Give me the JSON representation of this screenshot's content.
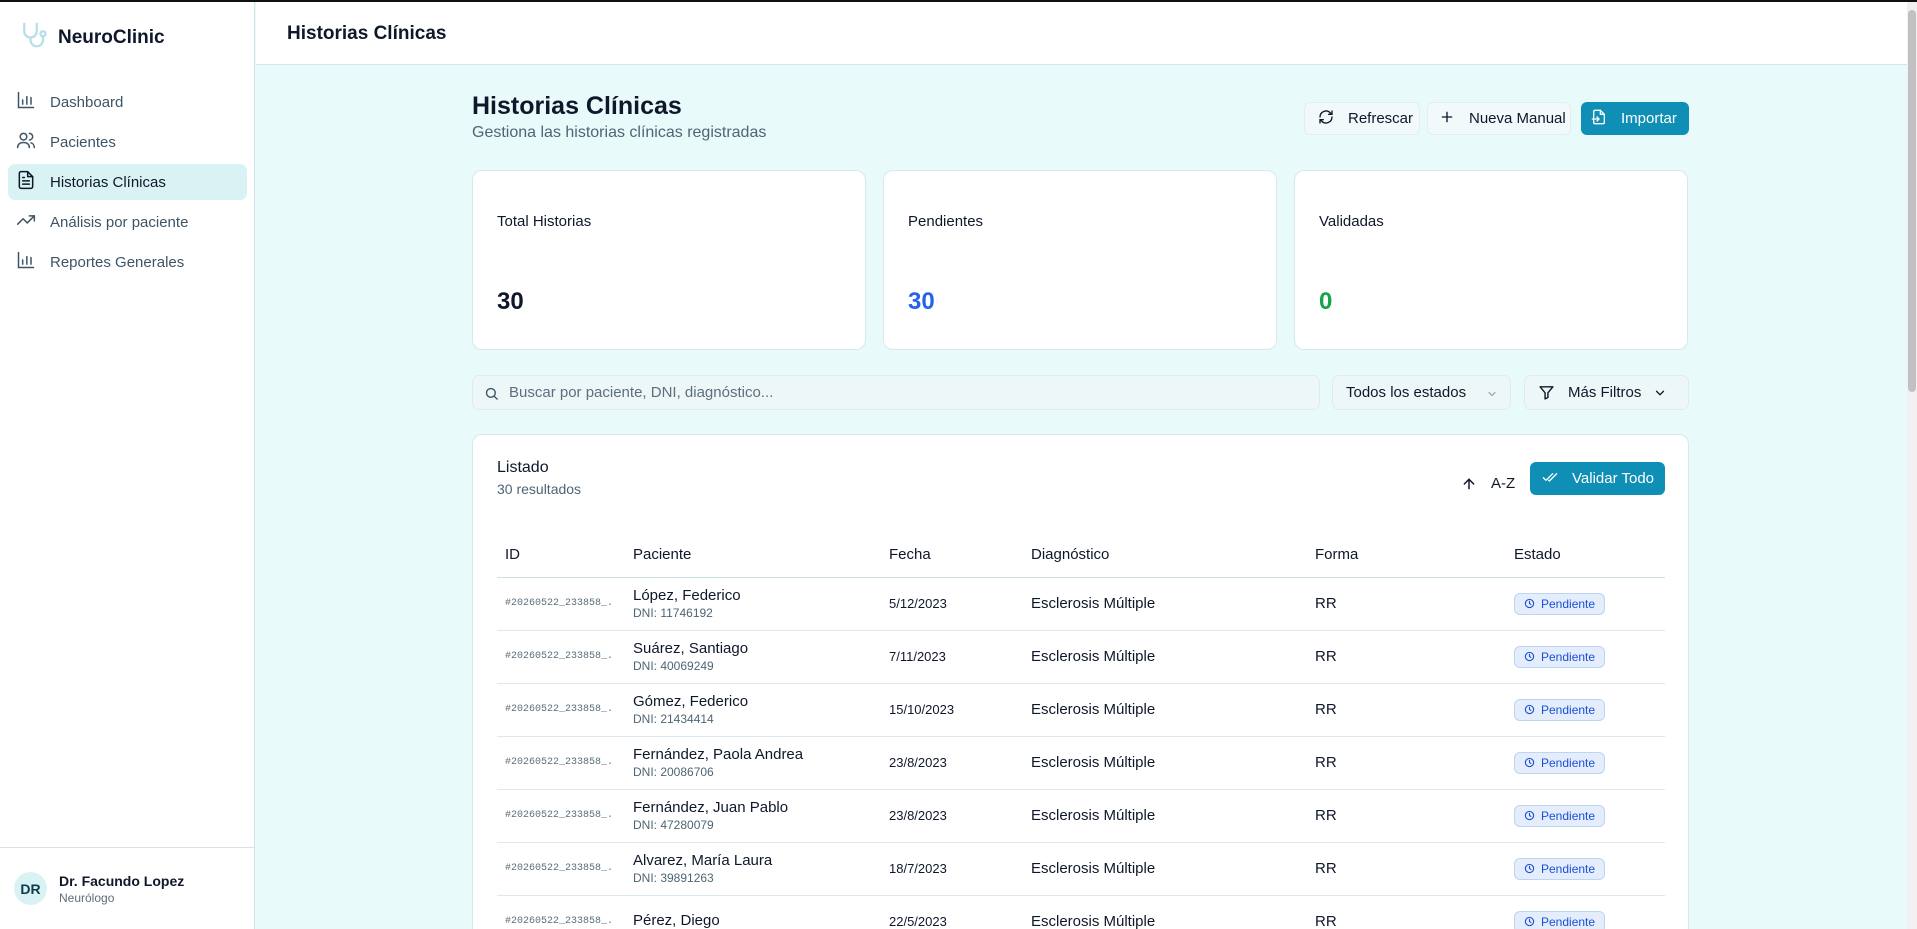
{
  "app": {
    "name": "NeuroClinic"
  },
  "sidebar": {
    "items": [
      {
        "label": "Dashboard",
        "icon": "bar-chart-icon",
        "active": false
      },
      {
        "label": "Pacientes",
        "icon": "users-icon",
        "active": false
      },
      {
        "label": "Historias Clínicas",
        "icon": "file-text-icon",
        "active": true
      },
      {
        "label": "Análisis por paciente",
        "icon": "trending-up-icon",
        "active": false
      },
      {
        "label": "Reportes Generales",
        "icon": "bar-chart-icon",
        "active": false
      }
    ],
    "user": {
      "initials": "DR",
      "name": "Dr. Facundo Lopez",
      "role": "Neurólogo"
    }
  },
  "header": {
    "title": "Historias Clínicas"
  },
  "page": {
    "title": "Historias Clínicas",
    "subtitle": "Gestiona las historias clínicas registradas",
    "actions": {
      "refresh": "Refrescar",
      "new_manual": "Nueva Manual",
      "import": "Importar"
    }
  },
  "stats": [
    {
      "label": "Total Historias",
      "value": "30",
      "color": "#0f172a"
    },
    {
      "label": "Pendientes",
      "value": "30",
      "color": "#2563eb"
    },
    {
      "label": "Validadas",
      "value": "0",
      "color": "#16a34a"
    }
  ],
  "filters": {
    "search_placeholder": "Buscar por paciente, DNI, diagnóstico...",
    "status_select": "Todos los estados",
    "more_filters": "Más Filtros"
  },
  "list": {
    "title": "Listado",
    "count": "30 resultados",
    "sort_label": "A-Z",
    "validate_all": "Validar Todo",
    "columns": [
      "ID",
      "Paciente",
      "Fecha",
      "Diagnóstico",
      "Forma",
      "Estado"
    ],
    "rows": [
      {
        "id": "#20260522_233858_...",
        "name": "López, Federico",
        "dni": "DNI: 11746192",
        "date": "5/12/2023",
        "diagnosis": "Esclerosis Múltiple",
        "form": "RR",
        "status": "Pendiente"
      },
      {
        "id": "#20260522_233858_...",
        "name": "Suárez, Santiago",
        "dni": "DNI: 40069249",
        "date": "7/11/2023",
        "diagnosis": "Esclerosis Múltiple",
        "form": "RR",
        "status": "Pendiente"
      },
      {
        "id": "#20260522_233858_...",
        "name": "Gómez, Federico",
        "dni": "DNI: 21434414",
        "date": "15/10/2023",
        "diagnosis": "Esclerosis Múltiple",
        "form": "RR",
        "status": "Pendiente"
      },
      {
        "id": "#20260522_233858_...",
        "name": "Fernández, Paola Andrea",
        "dni": "DNI: 20086706",
        "date": "23/8/2023",
        "diagnosis": "Esclerosis Múltiple",
        "form": "RR",
        "status": "Pendiente"
      },
      {
        "id": "#20260522_233858_...",
        "name": "Fernández, Juan Pablo",
        "dni": "DNI: 47280079",
        "date": "23/8/2023",
        "diagnosis": "Esclerosis Múltiple",
        "form": "RR",
        "status": "Pendiente"
      },
      {
        "id": "#20260522_233858_...",
        "name": "Alvarez, María Laura",
        "dni": "DNI: 39891263",
        "date": "18/7/2023",
        "diagnosis": "Esclerosis Múltiple",
        "form": "RR",
        "status": "Pendiente"
      },
      {
        "id": "#20260522_233858_...",
        "name": "Pérez, Diego",
        "dni": "",
        "date": "22/5/2023",
        "diagnosis": "Esclerosis Múltiple",
        "form": "RR",
        "status": "Pendiente"
      }
    ]
  }
}
